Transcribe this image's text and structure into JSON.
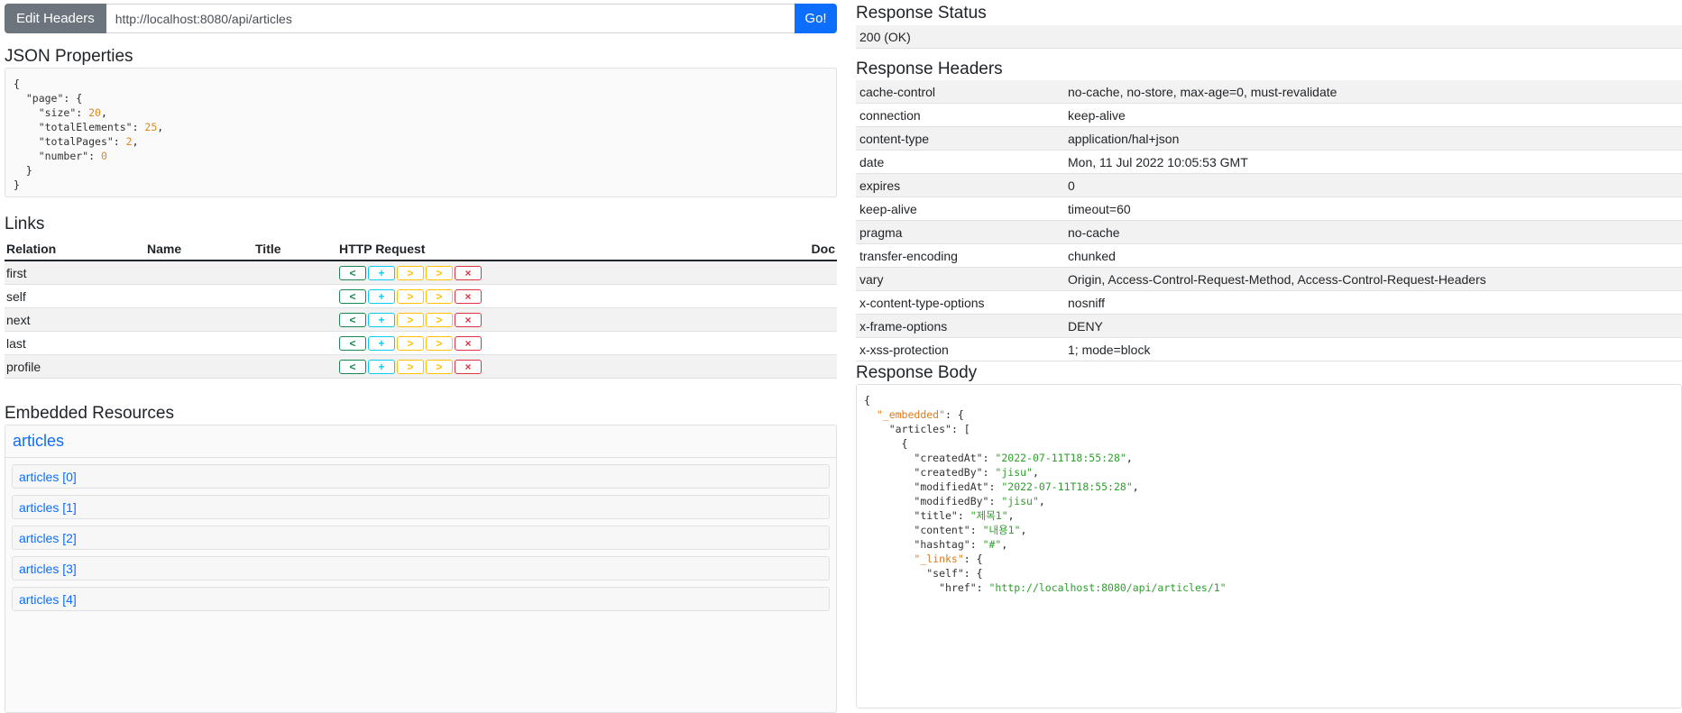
{
  "request": {
    "edit_headers_label": "Edit Headers",
    "url": "http://localhost:8080/api/articles",
    "go_label": "Go!"
  },
  "json_properties": {
    "title": "JSON Properties",
    "lines": [
      [
        {
          "t": "p",
          "v": "{"
        }
      ],
      [
        {
          "t": "p",
          "v": "  "
        },
        {
          "t": "k",
          "v": "\"page\""
        },
        {
          "t": "p",
          "v": ": {"
        }
      ],
      [
        {
          "t": "p",
          "v": "    "
        },
        {
          "t": "k",
          "v": "\"size\""
        },
        {
          "t": "p",
          "v": ": "
        },
        {
          "t": "num",
          "v": "20"
        },
        {
          "t": "p",
          "v": ","
        }
      ],
      [
        {
          "t": "p",
          "v": "    "
        },
        {
          "t": "k",
          "v": "\"totalElements\""
        },
        {
          "t": "p",
          "v": ": "
        },
        {
          "t": "num",
          "v": "25"
        },
        {
          "t": "p",
          "v": ","
        }
      ],
      [
        {
          "t": "p",
          "v": "    "
        },
        {
          "t": "k",
          "v": "\"totalPages\""
        },
        {
          "t": "p",
          "v": ": "
        },
        {
          "t": "num",
          "v": "2"
        },
        {
          "t": "p",
          "v": ","
        }
      ],
      [
        {
          "t": "p",
          "v": "    "
        },
        {
          "t": "k",
          "v": "\"number\""
        },
        {
          "t": "p",
          "v": ": "
        },
        {
          "t": "num",
          "v": "0"
        }
      ],
      [
        {
          "t": "p",
          "v": "  }"
        }
      ],
      [
        {
          "t": "p",
          "v": "}"
        }
      ]
    ]
  },
  "links": {
    "title": "Links",
    "headers": {
      "relation": "Relation",
      "name": "Name",
      "title": "Title",
      "http_request": "HTTP Request",
      "doc": "Doc"
    },
    "rows": [
      {
        "relation": "first",
        "name": "",
        "title": "",
        "doc": ""
      },
      {
        "relation": "self",
        "name": "",
        "title": "",
        "doc": ""
      },
      {
        "relation": "next",
        "name": "",
        "title": "",
        "doc": ""
      },
      {
        "relation": "last",
        "name": "",
        "title": "",
        "doc": ""
      },
      {
        "relation": "profile",
        "name": "",
        "title": "",
        "doc": ""
      }
    ],
    "buttons": [
      {
        "icon": "chevron-left-icon",
        "glyph": "<",
        "kind": "get"
      },
      {
        "icon": "plus-icon",
        "glyph": "+",
        "kind": "post"
      },
      {
        "icon": "chevron-right-icon",
        "glyph": ">",
        "kind": "put"
      },
      {
        "icon": "chevron-right-icon",
        "glyph": ">",
        "kind": "put"
      },
      {
        "icon": "close-icon",
        "glyph": "×",
        "kind": "del"
      }
    ]
  },
  "embedded": {
    "title": "Embedded Resources",
    "group": "articles",
    "items": [
      "articles [0]",
      "articles [1]",
      "articles [2]",
      "articles [3]",
      "articles [4]"
    ]
  },
  "response_status": {
    "title": "Response Status",
    "value": "200 (OK)"
  },
  "response_headers": {
    "title": "Response Headers",
    "rows": [
      {
        "key": "cache-control",
        "value": "no-cache, no-store, max-age=0, must-revalidate"
      },
      {
        "key": "connection",
        "value": "keep-alive"
      },
      {
        "key": "content-type",
        "value": "application/hal+json"
      },
      {
        "key": "date",
        "value": "Mon, 11 Jul 2022 10:05:53 GMT"
      },
      {
        "key": "expires",
        "value": "0"
      },
      {
        "key": "keep-alive",
        "value": "timeout=60"
      },
      {
        "key": "pragma",
        "value": "no-cache"
      },
      {
        "key": "transfer-encoding",
        "value": "chunked"
      },
      {
        "key": "vary",
        "value": "Origin, Access-Control-Request-Method, Access-Control-Request-Headers"
      },
      {
        "key": "x-content-type-options",
        "value": "nosniff"
      },
      {
        "key": "x-frame-options",
        "value": "DENY"
      },
      {
        "key": "x-xss-protection",
        "value": "1; mode=block"
      }
    ]
  },
  "response_body": {
    "title": "Response Body",
    "lines": [
      [
        {
          "t": "p",
          "v": "{"
        }
      ],
      [
        {
          "t": "p",
          "v": "  "
        },
        {
          "t": "ok",
          "v": "\"_embedded\""
        },
        {
          "t": "p",
          "v": ": {"
        }
      ],
      [
        {
          "t": "p",
          "v": "    "
        },
        {
          "t": "k",
          "v": "\"articles\""
        },
        {
          "t": "p",
          "v": ": ["
        }
      ],
      [
        {
          "t": "p",
          "v": "      {"
        }
      ],
      [
        {
          "t": "p",
          "v": "        "
        },
        {
          "t": "k",
          "v": "\"createdAt\""
        },
        {
          "t": "p",
          "v": ": "
        },
        {
          "t": "str",
          "v": "\"2022-07-11T18:55:28\""
        },
        {
          "t": "p",
          "v": ","
        }
      ],
      [
        {
          "t": "p",
          "v": "        "
        },
        {
          "t": "k",
          "v": "\"createdBy\""
        },
        {
          "t": "p",
          "v": ": "
        },
        {
          "t": "str",
          "v": "\"jisu\""
        },
        {
          "t": "p",
          "v": ","
        }
      ],
      [
        {
          "t": "p",
          "v": "        "
        },
        {
          "t": "k",
          "v": "\"modifiedAt\""
        },
        {
          "t": "p",
          "v": ": "
        },
        {
          "t": "str",
          "v": "\"2022-07-11T18:55:28\""
        },
        {
          "t": "p",
          "v": ","
        }
      ],
      [
        {
          "t": "p",
          "v": "        "
        },
        {
          "t": "k",
          "v": "\"modifiedBy\""
        },
        {
          "t": "p",
          "v": ": "
        },
        {
          "t": "str",
          "v": "\"jisu\""
        },
        {
          "t": "p",
          "v": ","
        }
      ],
      [
        {
          "t": "p",
          "v": "        "
        },
        {
          "t": "k",
          "v": "\"title\""
        },
        {
          "t": "p",
          "v": ": "
        },
        {
          "t": "str",
          "v": "\"제목1\""
        },
        {
          "t": "p",
          "v": ","
        }
      ],
      [
        {
          "t": "p",
          "v": "        "
        },
        {
          "t": "k",
          "v": "\"content\""
        },
        {
          "t": "p",
          "v": ": "
        },
        {
          "t": "str",
          "v": "\"내용1\""
        },
        {
          "t": "p",
          "v": ","
        }
      ],
      [
        {
          "t": "p",
          "v": "        "
        },
        {
          "t": "k",
          "v": "\"hashtag\""
        },
        {
          "t": "p",
          "v": ": "
        },
        {
          "t": "str",
          "v": "\"#\""
        },
        {
          "t": "p",
          "v": ","
        }
      ],
      [
        {
          "t": "p",
          "v": "        "
        },
        {
          "t": "ok",
          "v": "\"_links\""
        },
        {
          "t": "p",
          "v": ": {"
        }
      ],
      [
        {
          "t": "p",
          "v": "          "
        },
        {
          "t": "k",
          "v": "\"self\""
        },
        {
          "t": "p",
          "v": ": {"
        }
      ],
      [
        {
          "t": "p",
          "v": "            "
        },
        {
          "t": "k",
          "v": "\"href\""
        },
        {
          "t": "p",
          "v": ": "
        },
        {
          "t": "str",
          "v": "\"http://localhost:8080/api/articles/1\""
        }
      ]
    ]
  }
}
